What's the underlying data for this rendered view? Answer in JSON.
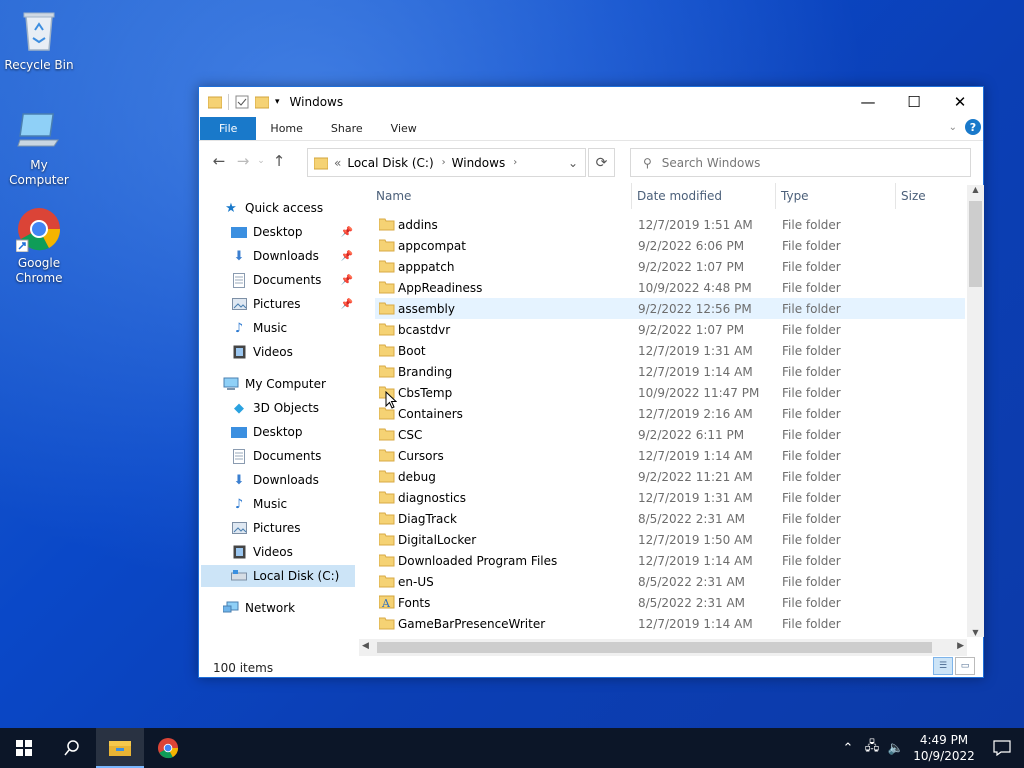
{
  "desktop": {
    "icons": [
      {
        "label": "Recycle Bin",
        "icon": "recycle-bin-icon"
      },
      {
        "label": "My Computer",
        "icon": "computer-icon"
      },
      {
        "label": "Google Chrome",
        "icon": "chrome-icon"
      }
    ]
  },
  "window": {
    "title": "Windows",
    "controls": {
      "minimize": "—",
      "maximize": "☐",
      "close": "✕"
    },
    "ribbon_tabs": [
      "File",
      "Home",
      "Share",
      "View"
    ],
    "help": "?",
    "address": {
      "crumbs": [
        "Local Disk (C:)",
        "Windows"
      ],
      "prefix": "«"
    },
    "search_placeholder": "Search Windows",
    "nav_pane": {
      "quick_access": "Quick access",
      "quick_items": [
        "Desktop",
        "Downloads",
        "Documents",
        "Pictures",
        "Music",
        "Videos"
      ],
      "my_computer": "My Computer",
      "computer_items": [
        "3D Objects",
        "Desktop",
        "Documents",
        "Downloads",
        "Music",
        "Pictures",
        "Videos",
        "Local Disk (C:)"
      ],
      "network": "Network"
    },
    "columns": {
      "name": "Name",
      "date": "Date modified",
      "type": "Type",
      "size": "Size"
    },
    "files": [
      {
        "name": "addins",
        "date": "12/7/2019 1:51 AM",
        "type": "File folder"
      },
      {
        "name": "appcompat",
        "date": "9/2/2022 6:06 PM",
        "type": "File folder"
      },
      {
        "name": "apppatch",
        "date": "9/2/2022 1:07 PM",
        "type": "File folder"
      },
      {
        "name": "AppReadiness",
        "date": "10/9/2022 4:48 PM",
        "type": "File folder"
      },
      {
        "name": "assembly",
        "date": "9/2/2022 12:56 PM",
        "type": "File folder"
      },
      {
        "name": "bcastdvr",
        "date": "9/2/2022 1:07 PM",
        "type": "File folder"
      },
      {
        "name": "Boot",
        "date": "12/7/2019 1:31 AM",
        "type": "File folder"
      },
      {
        "name": "Branding",
        "date": "12/7/2019 1:14 AM",
        "type": "File folder"
      },
      {
        "name": "CbsTemp",
        "date": "10/9/2022 11:47 PM",
        "type": "File folder"
      },
      {
        "name": "Containers",
        "date": "12/7/2019 2:16 AM",
        "type": "File folder"
      },
      {
        "name": "CSC",
        "date": "9/2/2022 6:11 PM",
        "type": "File folder"
      },
      {
        "name": "Cursors",
        "date": "12/7/2019 1:14 AM",
        "type": "File folder"
      },
      {
        "name": "debug",
        "date": "9/2/2022 11:21 AM",
        "type": "File folder"
      },
      {
        "name": "diagnostics",
        "date": "12/7/2019 1:31 AM",
        "type": "File folder"
      },
      {
        "name": "DiagTrack",
        "date": "8/5/2022 2:31 AM",
        "type": "File folder"
      },
      {
        "name": "DigitalLocker",
        "date": "12/7/2019 1:50 AM",
        "type": "File folder"
      },
      {
        "name": "Downloaded Program Files",
        "date": "12/7/2019 1:14 AM",
        "type": "File folder"
      },
      {
        "name": "en-US",
        "date": "8/5/2022 2:31 AM",
        "type": "File folder"
      },
      {
        "name": "Fonts",
        "date": "8/5/2022 2:31 AM",
        "type": "File folder"
      },
      {
        "name": "GameBarPresenceWriter",
        "date": "12/7/2019 1:14 AM",
        "type": "File folder"
      }
    ],
    "status": "100 items"
  },
  "taskbar": {
    "time": "4:49 PM",
    "date": "10/9/2022"
  },
  "colors": {
    "accent": "#1979ca",
    "folder": "#f5d274",
    "folder_dark": "#e0b34a",
    "selected": "#cce4f7",
    "hover": "#e5f3ff"
  }
}
